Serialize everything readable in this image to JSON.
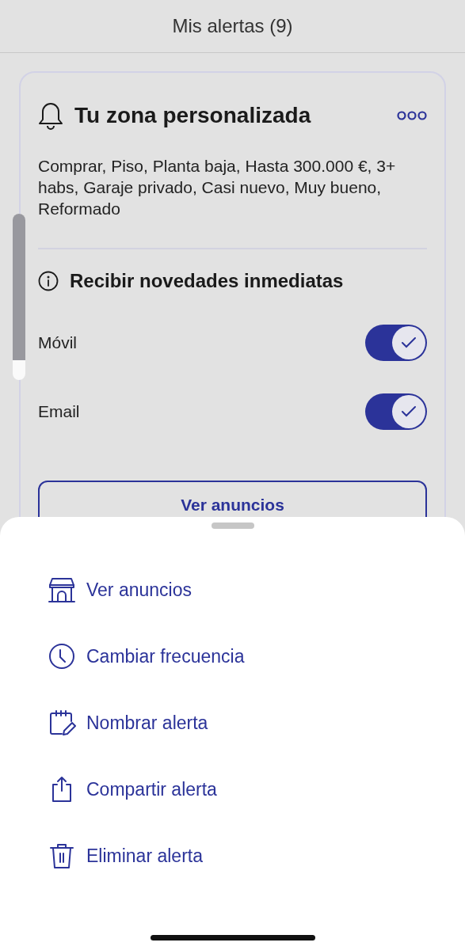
{
  "header": {
    "title": "Mis alertas (9)"
  },
  "alert": {
    "title": "Tu zona personalizada",
    "filters": "Comprar, Piso, Planta baja, Hasta 300.000 €, 3+ habs, Garaje privado, Casi nuevo, Muy bueno, Reformado",
    "section_title": "Recibir novedades inmediatas",
    "channels": [
      {
        "label": "Móvil",
        "on": true
      },
      {
        "label": "Email",
        "on": true
      }
    ],
    "button": "Ver anuncios"
  },
  "sheet": {
    "items": [
      {
        "kind": "store",
        "label": "Ver anuncios"
      },
      {
        "kind": "clock",
        "label": "Cambiar frecuencia"
      },
      {
        "kind": "rename",
        "label": "Nombrar alerta"
      },
      {
        "kind": "share",
        "label": "Compartir alerta"
      },
      {
        "kind": "trash",
        "label": "Eliminar alerta"
      }
    ]
  }
}
